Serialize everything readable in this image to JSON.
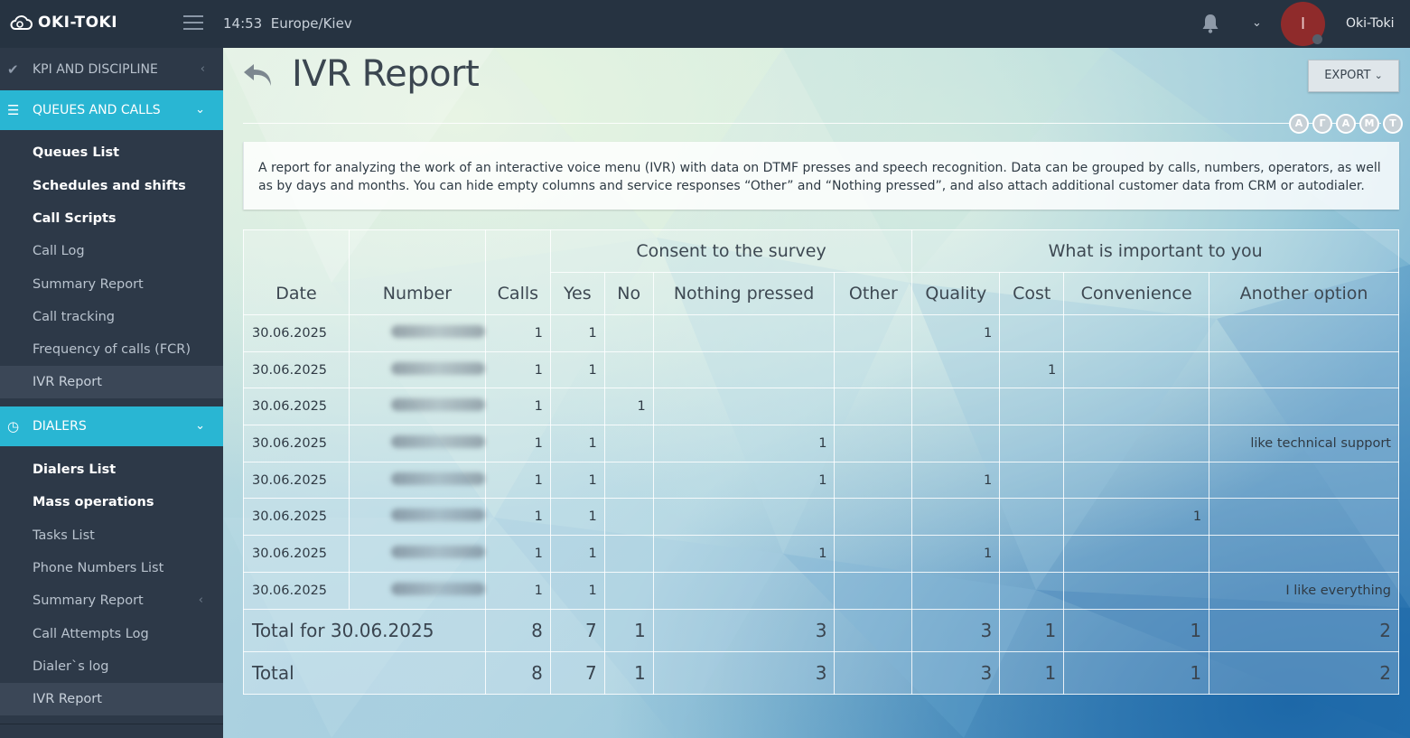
{
  "topbar": {
    "brand": "OKI-TOKI",
    "time": "14:53",
    "timezone": "Europe/Kiev",
    "avatar_letter": "I",
    "username": "Oki-Toki"
  },
  "sidebar": {
    "sections": [
      {
        "label": "KPI AND DISCIPLINE",
        "icon": "check-icon"
      },
      {
        "label": "QUEUES AND CALLS",
        "icon": "list-icon"
      },
      {
        "label": "DIALERS",
        "icon": "clock-icon"
      }
    ],
    "queues_items": [
      {
        "label": "Queues List"
      },
      {
        "label": "Schedules and shifts"
      },
      {
        "label": "Call Scripts"
      },
      {
        "label": "Call Log"
      },
      {
        "label": "Summary Report"
      },
      {
        "label": "Call tracking"
      },
      {
        "label": "Frequency of calls (FCR)"
      },
      {
        "label": "IVR Report"
      }
    ],
    "dialers_items": [
      {
        "label": "Dialers List"
      },
      {
        "label": "Mass operations"
      },
      {
        "label": "Tasks List"
      },
      {
        "label": "Phone Numbers List"
      },
      {
        "label": "Summary Report"
      },
      {
        "label": "Call Attempts Log"
      },
      {
        "label": "Dialer`s log"
      },
      {
        "label": "IVR Report"
      }
    ]
  },
  "page": {
    "title": "IVR Report",
    "export_label": "EXPORT",
    "letters": [
      "А",
      "Г",
      "А",
      "М",
      "Т"
    ],
    "description": "A report for analyzing the work of an interactive voice menu (IVR) with data on DTMF presses and speech recognition. Data can be grouped by calls, numbers, operators, as well as by days and months. You can hide empty columns and service responses “Other” and “Nothing pressed”, and also attach additional customer data from CRM or autodialer."
  },
  "table": {
    "groups": {
      "consent": "Consent to the survey",
      "important": "What is important to you"
    },
    "columns": {
      "date": "Date",
      "number": "Number",
      "calls": "Calls",
      "yes": "Yes",
      "no": "No",
      "nothing": "Nothing pressed",
      "other": "Other",
      "quality": "Quality",
      "cost": "Cost",
      "convenience": "Convenience",
      "another": "Another option"
    },
    "rows": [
      {
        "date": "30.06.2025",
        "calls": "1",
        "yes": "1",
        "no": "",
        "nothing": "",
        "other": "",
        "quality": "1",
        "cost": "",
        "convenience": "",
        "another": ""
      },
      {
        "date": "30.06.2025",
        "calls": "1",
        "yes": "1",
        "no": "",
        "nothing": "",
        "other": "",
        "quality": "",
        "cost": "1",
        "convenience": "",
        "another": ""
      },
      {
        "date": "30.06.2025",
        "calls": "1",
        "yes": "",
        "no": "1",
        "nothing": "",
        "other": "",
        "quality": "",
        "cost": "",
        "convenience": "",
        "another": ""
      },
      {
        "date": "30.06.2025",
        "calls": "1",
        "yes": "1",
        "no": "",
        "nothing": "1",
        "other": "",
        "quality": "",
        "cost": "",
        "convenience": "",
        "another": "like technical support"
      },
      {
        "date": "30.06.2025",
        "calls": "1",
        "yes": "1",
        "no": "",
        "nothing": "1",
        "other": "",
        "quality": "1",
        "cost": "",
        "convenience": "",
        "another": ""
      },
      {
        "date": "30.06.2025",
        "calls": "1",
        "yes": "1",
        "no": "",
        "nothing": "",
        "other": "",
        "quality": "",
        "cost": "",
        "convenience": "1",
        "another": ""
      },
      {
        "date": "30.06.2025",
        "calls": "1",
        "yes": "1",
        "no": "",
        "nothing": "1",
        "other": "",
        "quality": "1",
        "cost": "",
        "convenience": "",
        "another": ""
      },
      {
        "date": "30.06.2025",
        "calls": "1",
        "yes": "1",
        "no": "",
        "nothing": "",
        "other": "",
        "quality": "",
        "cost": "",
        "convenience": "",
        "another": "I like everything"
      }
    ],
    "subtotal": {
      "label": "Total for 30.06.2025",
      "calls": "8",
      "yes": "7",
      "no": "1",
      "nothing": "3",
      "other": "",
      "quality": "3",
      "cost": "1",
      "convenience": "1",
      "another": "2"
    },
    "total": {
      "label": "Total",
      "calls": "8",
      "yes": "7",
      "no": "1",
      "nothing": "3",
      "other": "",
      "quality": "3",
      "cost": "1",
      "convenience": "1",
      "another": "2"
    }
  }
}
